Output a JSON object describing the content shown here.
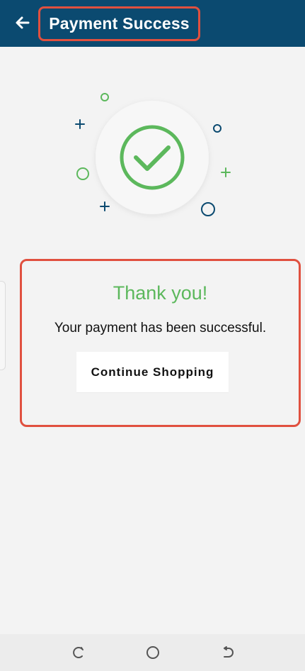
{
  "app_bar": {
    "title": "Payment Success",
    "back_icon": "arrow-left-icon"
  },
  "hero": {
    "icon": "check-circle-icon",
    "accent": "#5cb85c",
    "decor_color": "#0b4a70"
  },
  "result": {
    "heading": "Thank you!",
    "message": "Your payment has been successful.",
    "button_label": "Continue Shopping"
  },
  "nav_bar": {
    "recents_icon": "recents-icon",
    "home_icon": "home-circle-icon",
    "back_icon": "nav-back-icon"
  },
  "colors": {
    "header": "#0b4a70",
    "highlight": "#e0503f",
    "success": "#5cb85c",
    "background": "#f3f3f3"
  }
}
